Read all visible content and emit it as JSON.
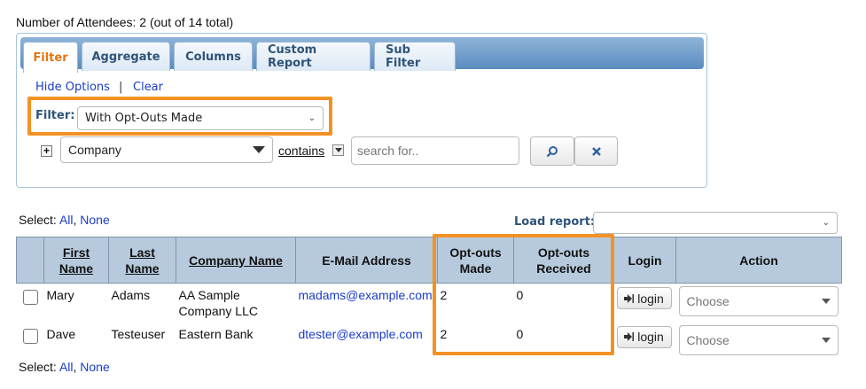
{
  "header": {
    "attendee_count": "Number of Attendees: 2 (out of 14 total)"
  },
  "tabs": [
    {
      "label": "Filter",
      "active": true
    },
    {
      "label": "Aggregate",
      "active": false
    },
    {
      "label": "Columns",
      "active": false
    },
    {
      "label": "Custom Report",
      "active": false
    },
    {
      "label": "Sub Filter",
      "active": false
    }
  ],
  "options": {
    "hide_options": "Hide Options",
    "separator": "|",
    "clear": "Clear"
  },
  "filter": {
    "label": "Filter:",
    "selected": "With Opt-Outs Made"
  },
  "criteria": {
    "add_symbol": "+",
    "field": "Company",
    "operator": "contains",
    "search_placeholder": "search for.."
  },
  "selection": {
    "prefix": "Select:",
    "all": "All",
    "comma": ",",
    "none": "None"
  },
  "load_report": {
    "label": "Load report:",
    "value": ""
  },
  "table": {
    "columns": {
      "first_name_1": "First",
      "first_name_2": "Name",
      "last_name_1": "Last",
      "last_name_2": "Name",
      "company": "Company Name",
      "email": "E-Mail Address",
      "optouts_made_1": "Opt-outs",
      "optouts_made_2": "Made",
      "optouts_received_1": "Opt-outs",
      "optouts_received_2": "Received",
      "login": "Login",
      "action": "Action"
    },
    "rows": [
      {
        "first": "Mary",
        "last": "Adams",
        "company": "AA Sample Company LLC",
        "email": "madams@example.com",
        "optouts_made": "2",
        "optouts_received": "0",
        "login": "login",
        "action": "Choose"
      },
      {
        "first": "Dave",
        "last": "Testeuser",
        "company": "Eastern Bank",
        "email": "dtester@example.com",
        "optouts_made": "2",
        "optouts_received": "0",
        "login": "login",
        "action": "Choose"
      }
    ]
  },
  "colors": {
    "highlight": "#f39224",
    "active_tab": "#e5750e",
    "link": "#1a3cc8",
    "header_bg": "#b7cadd"
  },
  "icons": {
    "search": "magnifier-icon",
    "clear": "x-icon",
    "login": "login-arrow-icon"
  }
}
